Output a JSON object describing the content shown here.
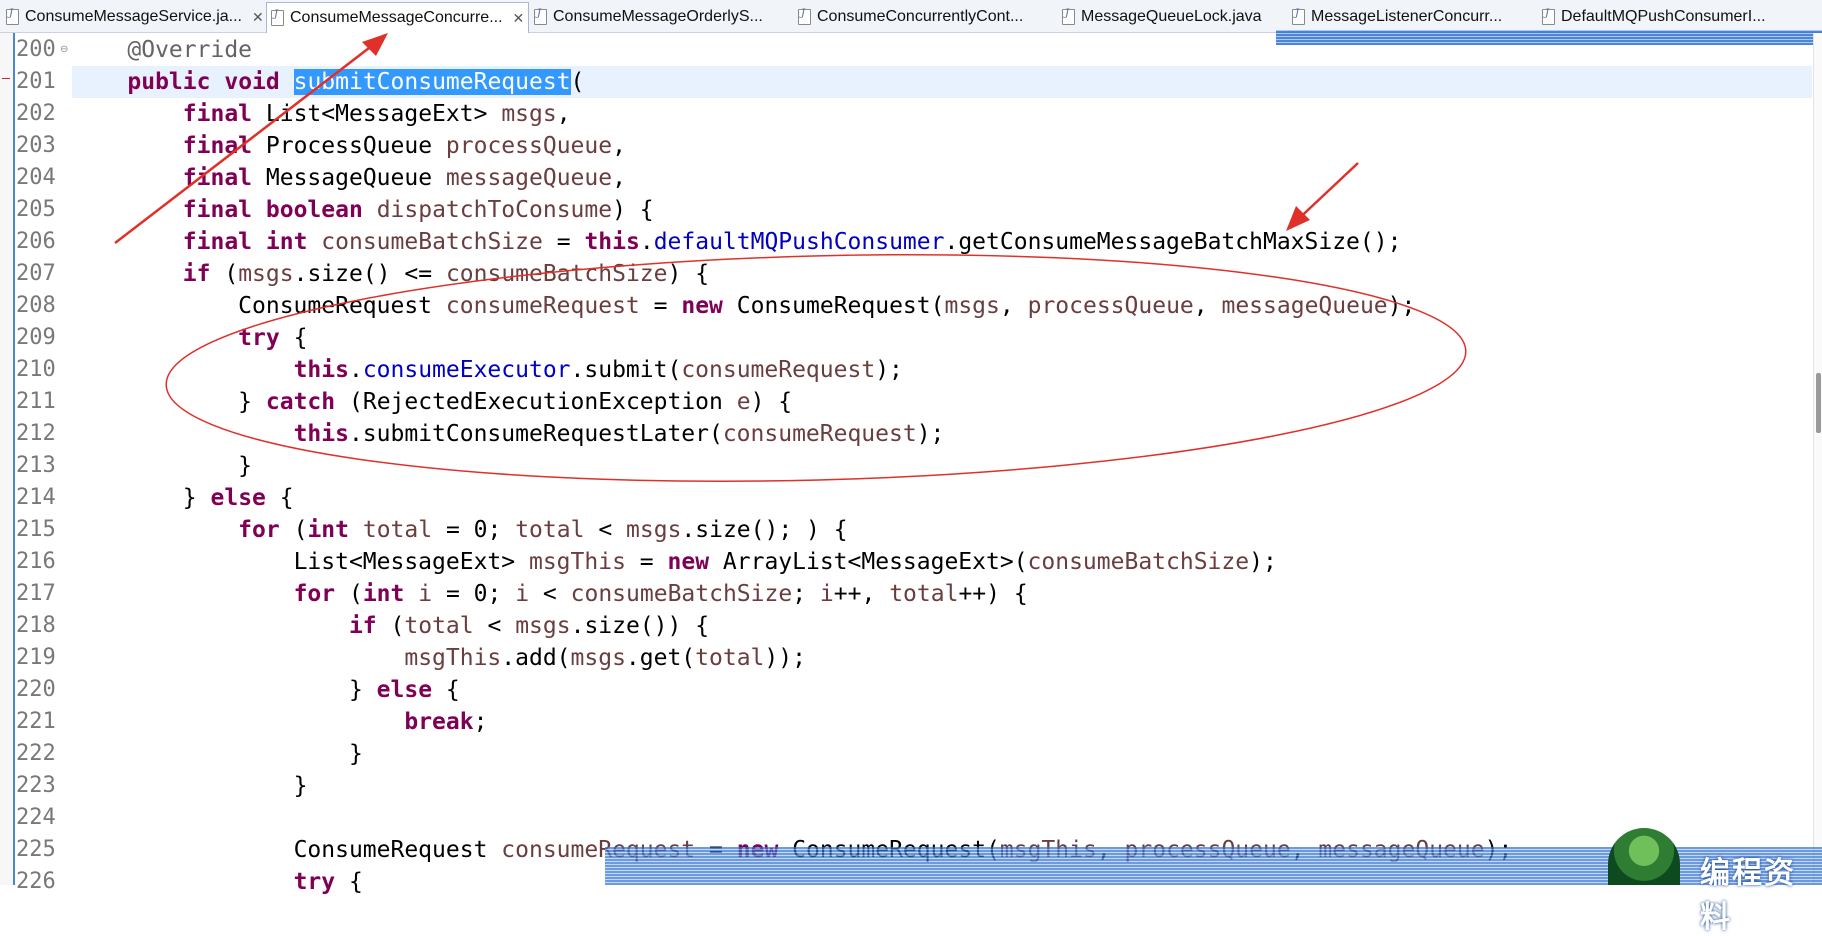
{
  "tabs": [
    {
      "label": "ConsumeMessageService.ja...",
      "active": false,
      "closable": true
    },
    {
      "label": "ConsumeMessageConcurre...",
      "active": true,
      "closable": true
    },
    {
      "label": "ConsumeMessageOrderlyS...",
      "active": false,
      "closable": false
    },
    {
      "label": "ConsumeConcurrentlyCont...",
      "active": false,
      "closable": false
    },
    {
      "label": "MessageQueueLock.java",
      "active": false,
      "closable": false
    },
    {
      "label": "MessageListenerConcurr...",
      "active": false,
      "closable": false
    },
    {
      "label": "DefaultMQPushConsumerI...",
      "active": false,
      "closable": false
    }
  ],
  "close_glyph": "✕",
  "line_numbers": [
    "200",
    "201",
    "202",
    "203",
    "204",
    "205",
    "206",
    "207",
    "208",
    "209",
    "210",
    "211",
    "212",
    "213",
    "214",
    "215",
    "216",
    "217",
    "218",
    "219",
    "220",
    "221",
    "222",
    "223",
    "224",
    "225",
    "226"
  ],
  "code": {
    "l200": {
      "ann": "@Override"
    },
    "l201": {
      "kw1": "public",
      "kw2": "void",
      "name": "submitConsumeRequest",
      "paren": "("
    },
    "l202": {
      "kw": "final",
      "type": "List<MessageExt>",
      "param": "msgs",
      "end": ","
    },
    "l203": {
      "kw": "final",
      "type": "ProcessQueue",
      "param": "processQueue",
      "end": ","
    },
    "l204": {
      "kw": "final",
      "type": "MessageQueue",
      "param": "messageQueue",
      "end": ","
    },
    "l205": {
      "kw1": "final",
      "kw2": "boolean",
      "param": "dispatchToConsume",
      "end": ") {"
    },
    "l206": {
      "kw1": "final",
      "kw2": "int",
      "var": "consumeBatchSize",
      "eq": "=",
      "kw3": "this",
      "dot": ".",
      "field": "defaultMQPushConsumer",
      "rest": ".getConsumeMessageBatchMaxSize();"
    },
    "l207": {
      "kw": "if",
      "p1": "(",
      "v1": "msgs",
      "p2": ".size() <=",
      "v2": "consumeBatchSize",
      "p3": ") {"
    },
    "l208": {
      "type": "ConsumeRequest",
      "var": "consumeRequest",
      "eq": "=",
      "kw": "new",
      "ctor": "ConsumeRequest(",
      "a1": "msgs",
      "c1": ",",
      "a2": "processQueue",
      "c2": ",",
      "a3": "messageQueue",
      "end": ");"
    },
    "l209": {
      "kw": "try",
      "end": "{"
    },
    "l210": {
      "kw": "this",
      "dot": ".",
      "field": "consumeExecutor",
      "call": ".submit(",
      "arg": "consumeRequest",
      "end": ");"
    },
    "l211": {
      "brace": "}",
      "kw": "catch",
      "p1": "(RejectedExecutionException",
      "var": "e",
      "end": ") {"
    },
    "l212": {
      "kw": "this",
      "call": ".submitConsumeRequestLater(",
      "arg": "consumeRequest",
      "end": ");"
    },
    "l213": {
      "brace": "}"
    },
    "l214": {
      "brace": "}",
      "kw": "else",
      "end": "{"
    },
    "l215": {
      "kw1": "for",
      "p1": "(",
      "kw2": "int",
      "v1": "total",
      "p2": "= 0;",
      "v2": "total",
      "p3": "<",
      "v3": "msgs",
      "p4": ".size(); ) {"
    },
    "l216": {
      "type": "List<MessageExt>",
      "var": "msgThis",
      "eq": "=",
      "kw": "new",
      "ctor": "ArrayList<MessageExt>(",
      "arg": "consumeBatchSize",
      "end": ");"
    },
    "l217": {
      "kw1": "for",
      "p1": "(",
      "kw2": "int",
      "v1": "i",
      "p2": "= 0;",
      "v2": "i",
      "p3": "<",
      "v3": "consumeBatchSize",
      "p4": ";",
      "v4": "i",
      "p5": "++,",
      "v5": "total",
      "p6": "++) {"
    },
    "l218": {
      "kw": "if",
      "p1": "(",
      "v1": "total",
      "p2": "<",
      "v2": "msgs",
      "p3": ".size()) {"
    },
    "l219": {
      "v1": "msgThis",
      "p1": ".add(",
      "v2": "msgs",
      "p2": ".get(",
      "v3": "total",
      "p3": "));"
    },
    "l220": {
      "brace": "}",
      "kw": "else",
      "end": "{"
    },
    "l221": {
      "kw": "break",
      "end": ";"
    },
    "l222": {
      "brace": "}"
    },
    "l223": {
      "brace": "}"
    },
    "l224": {
      "text": ""
    },
    "l225": {
      "type": "ConsumeRequest",
      "var": "consumeRequest",
      "eq": "=",
      "kw": "new",
      "ctor": "ConsumeRequest(",
      "a1": "msgThis",
      "c1": ",",
      "a2": "processQueue",
      "c2": ",",
      "a3": "messageQueue",
      "end": ");"
    },
    "l226": {
      "kw": "try",
      "end": "{"
    }
  },
  "watermark": {
    "text": "编程资料"
  },
  "colors": {
    "keyword": "#7f0055",
    "field": "#0000c0",
    "local": "#6a3e3e",
    "annotation": "#646464",
    "selection": "#3399ff",
    "current_line": "#e8f2fe",
    "annotation_red": "#e0302a"
  }
}
